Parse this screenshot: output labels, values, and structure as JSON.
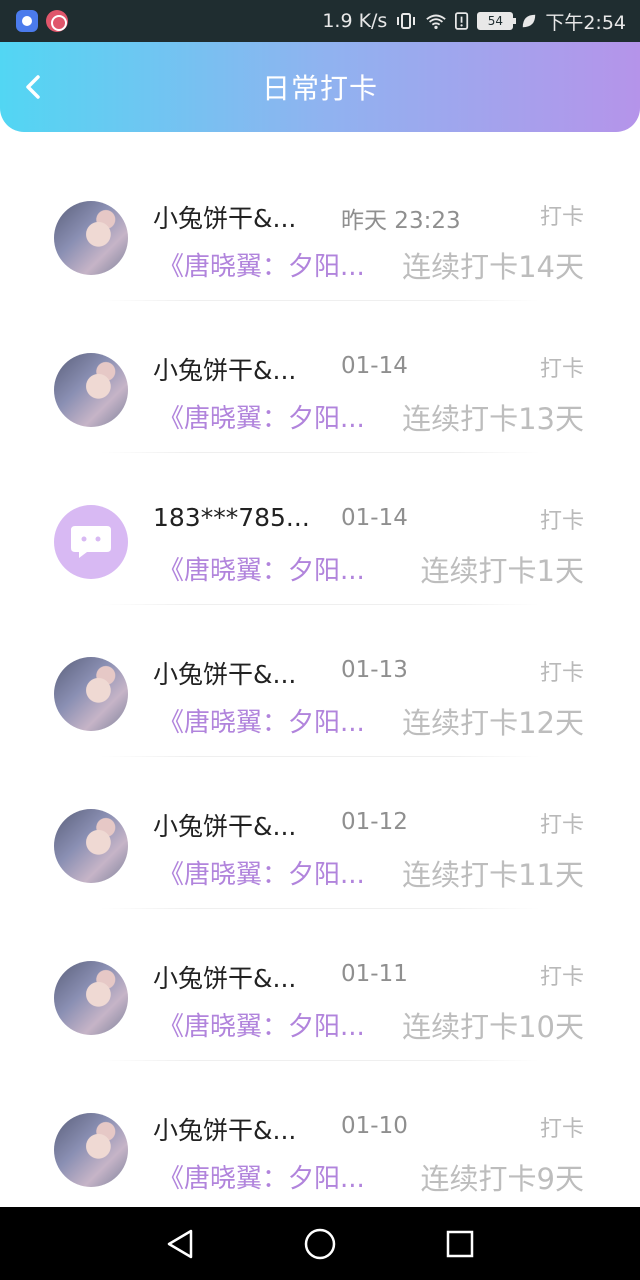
{
  "status_bar": {
    "speed": "1.9 K/s",
    "battery": "54",
    "time": "下午2:54"
  },
  "header": {
    "title": "日常打卡",
    "back_icon": "chevron-left-icon"
  },
  "entries": [
    {
      "name": "小兔饼干&...",
      "time": "昨天 23:23",
      "action": "打卡",
      "book": "《唐晓翼：夕阳...",
      "streak": "连续打卡14天",
      "avatar": "photo"
    },
    {
      "name": "小兔饼干&...",
      "time": "01-14",
      "action": "打卡",
      "book": "《唐晓翼：夕阳...",
      "streak": "连续打卡13天",
      "avatar": "photo"
    },
    {
      "name": "183***785...",
      "time": "01-14",
      "action": "打卡",
      "book": "《唐晓翼：夕阳...",
      "streak": "连续打卡1天",
      "avatar": "default"
    },
    {
      "name": "小兔饼干&...",
      "time": "01-13",
      "action": "打卡",
      "book": "《唐晓翼：夕阳...",
      "streak": "连续打卡12天",
      "avatar": "photo"
    },
    {
      "name": "小兔饼干&...",
      "time": "01-12",
      "action": "打卡",
      "book": "《唐晓翼：夕阳...",
      "streak": "连续打卡11天",
      "avatar": "photo"
    },
    {
      "name": "小兔饼干&...",
      "time": "01-11",
      "action": "打卡",
      "book": "《唐晓翼：夕阳...",
      "streak": "连续打卡10天",
      "avatar": "photo"
    },
    {
      "name": "小兔饼干&...",
      "time": "01-10",
      "action": "打卡",
      "book": "《唐晓翼：夕阳...",
      "streak": "连续打卡9天",
      "avatar": "photo"
    }
  ],
  "nav": {
    "back_icon": "triangle-back-icon",
    "home_icon": "circle-home-icon",
    "recents_icon": "square-recents-icon"
  },
  "colors": {
    "header_gradient_start": "#52d6f3",
    "header_gradient_end": "#b594ea",
    "book_link": "#b184dc",
    "default_avatar": "#d8b9f3"
  }
}
